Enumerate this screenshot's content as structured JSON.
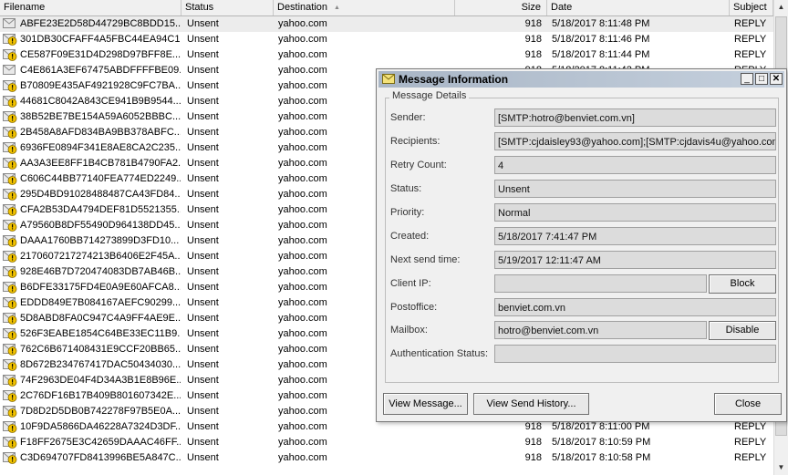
{
  "columns": {
    "filename": "Filename",
    "status": "Status",
    "destination": "Destination",
    "size": "Size",
    "date": "Date",
    "subject": "Subject"
  },
  "rows": [
    {
      "filename": "ABFE23E2D58D44729BC8BDD15...",
      "status": "Unsent",
      "destination": "yahoo.com",
      "size": "918",
      "date": "5/18/2017 8:11:48 PM",
      "subject": "REPLY",
      "icon": "envelope-icon",
      "selected": true
    },
    {
      "filename": "301DB30CFAFF4A5FBC44EA94C1...",
      "status": "Unsent",
      "destination": "yahoo.com",
      "size": "918",
      "date": "5/18/2017 8:11:46 PM",
      "subject": "REPLY",
      "icon": "warning-envelope-icon"
    },
    {
      "filename": "CE587F09E31D4D298D97BFF8E...",
      "status": "Unsent",
      "destination": "yahoo.com",
      "size": "918",
      "date": "5/18/2017 8:11:44 PM",
      "subject": "REPLY",
      "icon": "warning-envelope-icon"
    },
    {
      "filename": "C4E861A3EF67475ABDFFFFBE09...",
      "status": "Unsent",
      "destination": "yahoo.com",
      "size": "918",
      "date": "5/18/2017 8:11:42 PM",
      "subject": "REPLY",
      "icon": "envelope-icon"
    },
    {
      "filename": "B70809E435AF4921928C9FC7BA...",
      "status": "Unsent",
      "destination": "yahoo.com",
      "size": "",
      "date": "",
      "subject": "",
      "icon": "warning-envelope-icon"
    },
    {
      "filename": "44681C8042A843CE941B9B9544...",
      "status": "Unsent",
      "destination": "yahoo.com",
      "size": "",
      "date": "",
      "subject": "",
      "icon": "warning-envelope-icon"
    },
    {
      "filename": "38B52BE7BE154A59A6052BBBC...",
      "status": "Unsent",
      "destination": "yahoo.com",
      "size": "",
      "date": "",
      "subject": "",
      "icon": "warning-envelope-icon"
    },
    {
      "filename": "2B458A8AFD834BA9BB378ABFC...",
      "status": "Unsent",
      "destination": "yahoo.com",
      "size": "",
      "date": "",
      "subject": "",
      "icon": "warning-envelope-icon"
    },
    {
      "filename": "6936FE0894F341E8AE8CA2C235...",
      "status": "Unsent",
      "destination": "yahoo.com",
      "size": "",
      "date": "",
      "subject": "",
      "icon": "warning-envelope-icon"
    },
    {
      "filename": "AA3A3EE8FF1B4CB781B4790FA2...",
      "status": "Unsent",
      "destination": "yahoo.com",
      "size": "",
      "date": "",
      "subject": "",
      "icon": "warning-envelope-icon"
    },
    {
      "filename": "C606C44BB77140FEA774ED2249...",
      "status": "Unsent",
      "destination": "yahoo.com",
      "size": "",
      "date": "",
      "subject": "",
      "icon": "warning-envelope-icon"
    },
    {
      "filename": "295D4BD91028488487CA43FD84...",
      "status": "Unsent",
      "destination": "yahoo.com",
      "size": "",
      "date": "",
      "subject": "",
      "icon": "warning-envelope-icon"
    },
    {
      "filename": "CFA2B53DA4794DEF81D5521355...",
      "status": "Unsent",
      "destination": "yahoo.com",
      "size": "",
      "date": "",
      "subject": "",
      "icon": "warning-envelope-icon"
    },
    {
      "filename": "A79560B8DF55490D964138DD45...",
      "status": "Unsent",
      "destination": "yahoo.com",
      "size": "",
      "date": "",
      "subject": "",
      "icon": "warning-envelope-icon"
    },
    {
      "filename": "DAAA1760BB714273899D3FD10...",
      "status": "Unsent",
      "destination": "yahoo.com",
      "size": "",
      "date": "",
      "subject": "",
      "icon": "warning-envelope-icon"
    },
    {
      "filename": "2170607217274213B6406E2F45A...",
      "status": "Unsent",
      "destination": "yahoo.com",
      "size": "",
      "date": "",
      "subject": "",
      "icon": "warning-envelope-icon"
    },
    {
      "filename": "928E46B7D720474083DB7AB46B...",
      "status": "Unsent",
      "destination": "yahoo.com",
      "size": "",
      "date": "",
      "subject": "",
      "icon": "warning-envelope-icon"
    },
    {
      "filename": "B6DFE33175FD4E0A9E60AFCA8...",
      "status": "Unsent",
      "destination": "yahoo.com",
      "size": "",
      "date": "",
      "subject": "",
      "icon": "warning-envelope-icon"
    },
    {
      "filename": "EDDD849E7B084167AEFC90299...",
      "status": "Unsent",
      "destination": "yahoo.com",
      "size": "",
      "date": "",
      "subject": "",
      "icon": "warning-envelope-icon"
    },
    {
      "filename": "5D8ABD8FA0C947C4A9FF4AE9E...",
      "status": "Unsent",
      "destination": "yahoo.com",
      "size": "",
      "date": "",
      "subject": "",
      "icon": "warning-envelope-icon"
    },
    {
      "filename": "526F3EABE1854C64BE33EC11B9...",
      "status": "Unsent",
      "destination": "yahoo.com",
      "size": "",
      "date": "",
      "subject": "",
      "icon": "warning-envelope-icon"
    },
    {
      "filename": "762C6B671408431E9CCF20BB65...",
      "status": "Unsent",
      "destination": "yahoo.com",
      "size": "",
      "date": "",
      "subject": "",
      "icon": "warning-envelope-icon"
    },
    {
      "filename": "8D672B234767417DAC50434030...",
      "status": "Unsent",
      "destination": "yahoo.com",
      "size": "",
      "date": "",
      "subject": "",
      "icon": "warning-envelope-icon"
    },
    {
      "filename": "74F2963DE04F4D34A3B1E8B96E...",
      "status": "Unsent",
      "destination": "yahoo.com",
      "size": "",
      "date": "",
      "subject": "",
      "icon": "warning-envelope-icon"
    },
    {
      "filename": "2C76DF16B17B409B801607342E...",
      "status": "Unsent",
      "destination": "yahoo.com",
      "size": "",
      "date": "",
      "subject": "",
      "icon": "warning-envelope-icon"
    },
    {
      "filename": "7D8D2D5DB0B742278F97B5E0A...",
      "status": "Unsent",
      "destination": "yahoo.com",
      "size": "",
      "date": "",
      "subject": "",
      "icon": "warning-envelope-icon"
    },
    {
      "filename": "10F9DA5866DA46228A7324D3DF...",
      "status": "Unsent",
      "destination": "yahoo.com",
      "size": "918",
      "date": "5/18/2017 8:11:00 PM",
      "subject": "REPLY",
      "icon": "warning-envelope-icon"
    },
    {
      "filename": "F18FF2675E3C42659DAAAC46FF...",
      "status": "Unsent",
      "destination": "yahoo.com",
      "size": "918",
      "date": "5/18/2017 8:10:59 PM",
      "subject": "REPLY",
      "icon": "warning-envelope-icon"
    },
    {
      "filename": "C3D694707FD8413996BE5A847C...",
      "status": "Unsent",
      "destination": "yahoo.com",
      "size": "918",
      "date": "5/18/2017 8:10:58 PM",
      "subject": "REPLY",
      "icon": "warning-envelope-icon"
    }
  ],
  "dialog": {
    "title": "Message Information",
    "group_label": "Message Details",
    "sender_label": "Sender:",
    "sender_value": "[SMTP:hotro@benviet.com.vn]",
    "recipients_label": "Recipients:",
    "recipients_value": "[SMTP:cjdaisley93@yahoo.com];[SMTP:cjdavis4u@yahoo.com]",
    "retry_label": "Retry Count:",
    "retry_value": "4",
    "status_label": "Status:",
    "status_value": "Unsent",
    "priority_label": "Priority:",
    "priority_value": "Normal",
    "created_label": "Created:",
    "created_value": "5/18/2017 7:41:47 PM",
    "next_send_label": "Next send time:",
    "next_send_value": "5/19/2017 12:11:47 AM",
    "client_ip_label": "Client IP:",
    "client_ip_value": "",
    "block_label": "Block",
    "postoffice_label": "Postoffice:",
    "postoffice_value": "benviet.com.vn",
    "mailbox_label": "Mailbox:",
    "mailbox_value": "hotro@benviet.com.vn",
    "disable_label": "Disable",
    "auth_label": "Authentication Status:",
    "auth_value": "",
    "view_message_label": "View Message...",
    "view_history_label": "View Send History...",
    "close_label": "Close"
  },
  "colors": {
    "selected_row": "#ececec",
    "field_bg": "#dcdcdc",
    "dialog_bg": "#f0f0f0",
    "warning_yellow": "#f2c300"
  }
}
